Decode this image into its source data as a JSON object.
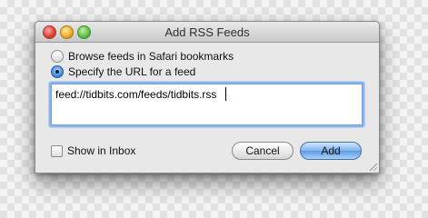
{
  "window": {
    "title": "Add RSS Feeds"
  },
  "options": [
    {
      "label": "Browse feeds in Safari bookmarks",
      "selected": false
    },
    {
      "label": "Specify the URL for a feed",
      "selected": true
    }
  ],
  "url_field": {
    "value": "feed://tidbits.com/feeds/tidbits.rss"
  },
  "show_in_inbox": {
    "label": "Show in Inbox",
    "checked": false
  },
  "buttons": {
    "cancel_label": "Cancel",
    "add_label": "Add"
  },
  "colors": {
    "accent": "#5d9ae3",
    "focus_ring": "#86b4ee"
  }
}
